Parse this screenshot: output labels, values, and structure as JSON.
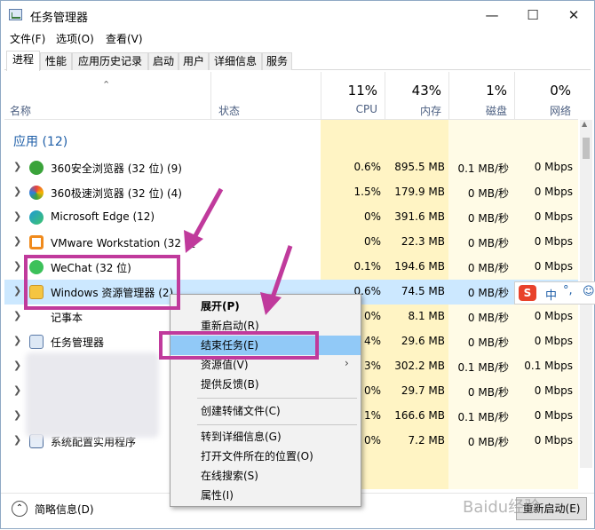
{
  "window": {
    "title": "任务管理器"
  },
  "menu": [
    "文件(F)",
    "选项(O)",
    "查看(V)"
  ],
  "tabs": [
    "进程",
    "性能",
    "应用历史记录",
    "启动",
    "用户",
    "详细信息",
    "服务"
  ],
  "columns": {
    "name": "名称",
    "status": "状态",
    "cpu": {
      "pct": "11%",
      "label": "CPU"
    },
    "mem": {
      "pct": "43%",
      "label": "内存"
    },
    "disk": {
      "pct": "1%",
      "label": "磁盘"
    },
    "net": {
      "pct": "0%",
      "label": "网络"
    }
  },
  "group_label": "应用 (12)",
  "rows": [
    {
      "name": "360安全浏览器 (32 位) (9)",
      "cpu": "0.6%",
      "mem": "895.5 MB",
      "disk": "0.1 MB/秒",
      "net": "0 Mbps"
    },
    {
      "name": "360极速浏览器 (32 位) (4)",
      "cpu": "1.5%",
      "mem": "179.9 MB",
      "disk": "0 MB/秒",
      "net": "0 Mbps"
    },
    {
      "name": "Microsoft Edge (12)",
      "cpu": "0%",
      "mem": "391.6 MB",
      "disk": "0 MB/秒",
      "net": "0 Mbps"
    },
    {
      "name": "VMware Workstation (32 位",
      "cpu": "0%",
      "mem": "22.3 MB",
      "disk": "0 MB/秒",
      "net": "0 Mbps"
    },
    {
      "name": "WeChat (32 位)",
      "cpu": "0.1%",
      "mem": "194.6 MB",
      "disk": "0 MB/秒",
      "net": "0 Mbps"
    },
    {
      "name": "Windows 资源管理器 (2)",
      "cpu": "0.6%",
      "mem": "74.5 MB",
      "disk": "0 MB/秒",
      "net": ""
    },
    {
      "name": "记事本",
      "cpu": "0%",
      "mem": "8.1 MB",
      "disk": "0 MB/秒",
      "net": "0 Mbps"
    },
    {
      "name": "任务管理器",
      "cpu": "4%",
      "mem": "29.6 MB",
      "disk": "0 MB/秒",
      "net": "0 Mbps"
    },
    {
      "name": "",
      "cpu": "3%",
      "mem": "302.2 MB",
      "disk": "0.1 MB/秒",
      "net": "0.1 Mbps"
    },
    {
      "name": "",
      "cpu": "0%",
      "mem": "29.7 MB",
      "disk": "0 MB/秒",
      "net": "0 Mbps"
    },
    {
      "name": "",
      "cpu": "1%",
      "mem": "166.6 MB",
      "disk": "0.1 MB/秒",
      "net": "0 Mbps"
    },
    {
      "name": "系统配置实用程序",
      "cpu": "0%",
      "mem": "7.2 MB",
      "disk": "0 MB/秒",
      "net": "0 Mbps"
    }
  ],
  "context_menu": [
    "展开(P)",
    "重新启动(R)",
    "结束任务(E)",
    "资源值(V)",
    "提供反馈(B)",
    "创建转储文件(C)",
    "转到详细信息(G)",
    "打开文件所在的位置(O)",
    "在线搜索(S)",
    "属性(I)"
  ],
  "footer": {
    "less_details": "简略信息(D)",
    "restart_button": "重新启动(E)"
  },
  "ime": "中",
  "watermark": "Baidu经验",
  "colors": {
    "cpu_col": "#fff4c4",
    "mem_col": "#fff4c4",
    "group": "#1f5fa8",
    "highlight": "#c03a9c",
    "menu_hl": "#91c9f7"
  }
}
